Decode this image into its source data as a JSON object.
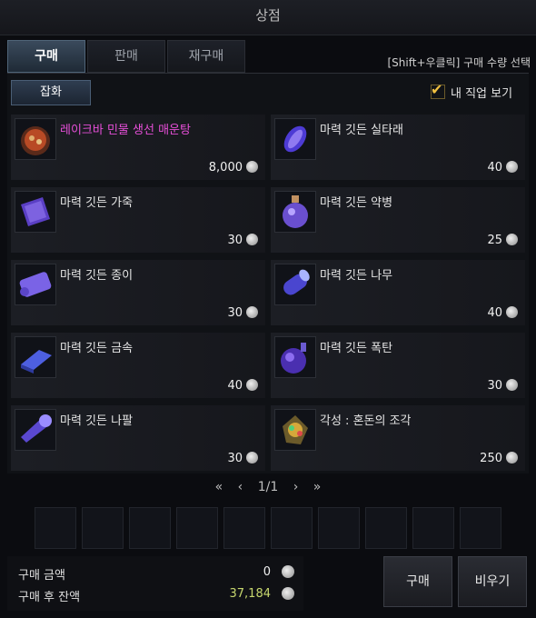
{
  "window": {
    "title": "상점"
  },
  "tabs": [
    {
      "label": "구매"
    },
    {
      "label": "판매"
    },
    {
      "label": "재구매"
    }
  ],
  "hint": "[Shift+우클릭] 구매 수량 선택",
  "category": {
    "label": "잡화"
  },
  "job_filter": {
    "label": "내 직업 보기",
    "checked": true
  },
  "items": [
    {
      "name": "레이크바 민물 생선 매운탕",
      "price": "8,000",
      "icon": "stew-pot-icon",
      "highlight": true
    },
    {
      "name": "마력 깃든 실타래",
      "price": "40",
      "icon": "thread-spool-icon"
    },
    {
      "name": "마력 깃든 가죽",
      "price": "30",
      "icon": "leather-icon"
    },
    {
      "name": "마력 깃든 약병",
      "price": "25",
      "icon": "potion-bottle-icon"
    },
    {
      "name": "마력 깃든 종이",
      "price": "30",
      "icon": "scroll-paper-icon"
    },
    {
      "name": "마력 깃든 나무",
      "price": "40",
      "icon": "wood-log-icon"
    },
    {
      "name": "마력 깃든 금속",
      "price": "40",
      "icon": "metal-ingot-icon"
    },
    {
      "name": "마력 깃든 폭탄",
      "price": "30",
      "icon": "bomb-icon"
    },
    {
      "name": "마력 깃든 나팔",
      "price": "30",
      "icon": "horn-icon"
    },
    {
      "name": "각성 : 혼돈의 조각",
      "price": "250",
      "icon": "chaos-fragment-icon"
    }
  ],
  "pager": {
    "first": "«",
    "prev": "‹",
    "page": "1/1",
    "next": "›",
    "last": "»"
  },
  "summary": {
    "cost_label": "구매 금액",
    "cost_value": "0",
    "balance_label": "구매 후 잔액",
    "balance_value": "37,184"
  },
  "buttons": {
    "buy": "구매",
    "clear": "비우기"
  },
  "colors": {
    "accent_tab": "#3a4a5c",
    "highlight_item": "#e64fd8",
    "balance": "#c7d76e"
  }
}
